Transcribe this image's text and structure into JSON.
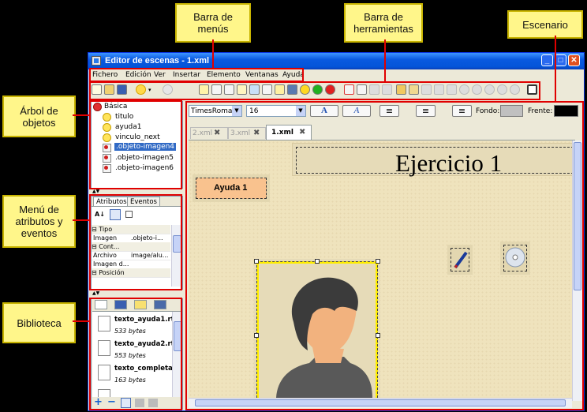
{
  "callouts": {
    "menu_bar": "Barra de menús",
    "toolbar": "Barra de herramientas",
    "stage": "Escenario",
    "object_tree": "Árbol de objetos",
    "attributes_menu": "Menú de atributos y eventos",
    "library": "Biblioteca"
  },
  "window": {
    "title": "Editor de escenas - 1.xml"
  },
  "menu": [
    "Fichero",
    "Edición",
    "Ver",
    "Insertar",
    "Elemento",
    "Ventanas",
    "Ayuda"
  ],
  "tree": {
    "root": "Básica",
    "items": [
      "titulo",
      "ayuda1",
      "vinculo_next",
      ".objeto-imagen4",
      ".objeto-imagen5",
      ".objeto-imagen6"
    ]
  },
  "attributes": {
    "tabs": [
      "Atributos",
      "Eventos"
    ],
    "sections": {
      "tipo": "Tipo",
      "content": "Cont...",
      "position": "Posición"
    },
    "rows": [
      {
        "name": "Imagen",
        "value": ".objeto-i..."
      },
      {
        "name": "Archivo",
        "value": "image/alu..."
      },
      {
        "name": "Imagen d...",
        "value": ""
      }
    ]
  },
  "library": {
    "items": [
      {
        "name": "texto_ayuda1.rt",
        "size": "533 bytes"
      },
      {
        "name": "texto_ayuda2.rt",
        "size": "553 bytes"
      },
      {
        "name": "texto_completa",
        "size": "163 bytes"
      }
    ]
  },
  "format": {
    "font": "TimesRoman",
    "size": "16",
    "background_label": "Fondo:",
    "foreground_label": "Frente:",
    "background_color": "#c0c0c0",
    "foreground_color": "#000000"
  },
  "tabs": [
    "2.xml",
    "3.xml",
    "1.xml"
  ],
  "stage": {
    "title": "Ejercicio 1",
    "help_button": "Ayuda 1"
  },
  "colors": {
    "accent_red": "#e00000",
    "callout_bg": "#fff68a",
    "selection_yellow": "#ffee00"
  }
}
